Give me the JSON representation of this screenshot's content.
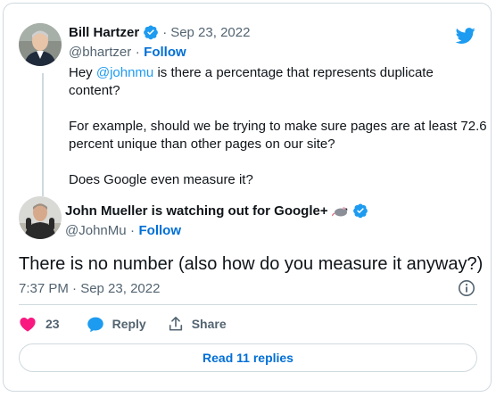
{
  "original_tweet": {
    "author_name": "Bill Hartzer",
    "date": "Sep 23, 2022",
    "handle": "@bhartzer",
    "follow_label": "Follow",
    "text_prefix": "Hey ",
    "mention": "@johnmu",
    "text_line1_rest": " is there a percentage that represents duplicate",
    "text_line2": "content?",
    "text_line3": "For example, should we be trying to make sure pages are at least 72.6",
    "text_line4": "percent unique than other pages on our site?",
    "text_line5": "Does Google even measure it?"
  },
  "reply_tweet": {
    "author_name": "John Mueller is watching out for Google+",
    "handle": "@JohnMu",
    "follow_label": "Follow",
    "text": "There is no number (also how do you measure it anyway?)",
    "timestamp": "7:37 PM · Sep 23, 2022"
  },
  "actions": {
    "like_count": "23",
    "reply_label": "Reply",
    "share_label": "Share"
  },
  "replies_button": {
    "label": "Read 11 replies"
  },
  "separator": "·",
  "colors": {
    "twitter_blue": "#1d9bf0",
    "like_red": "#f91880",
    "text_muted": "#536471",
    "border": "#cfd9de"
  }
}
